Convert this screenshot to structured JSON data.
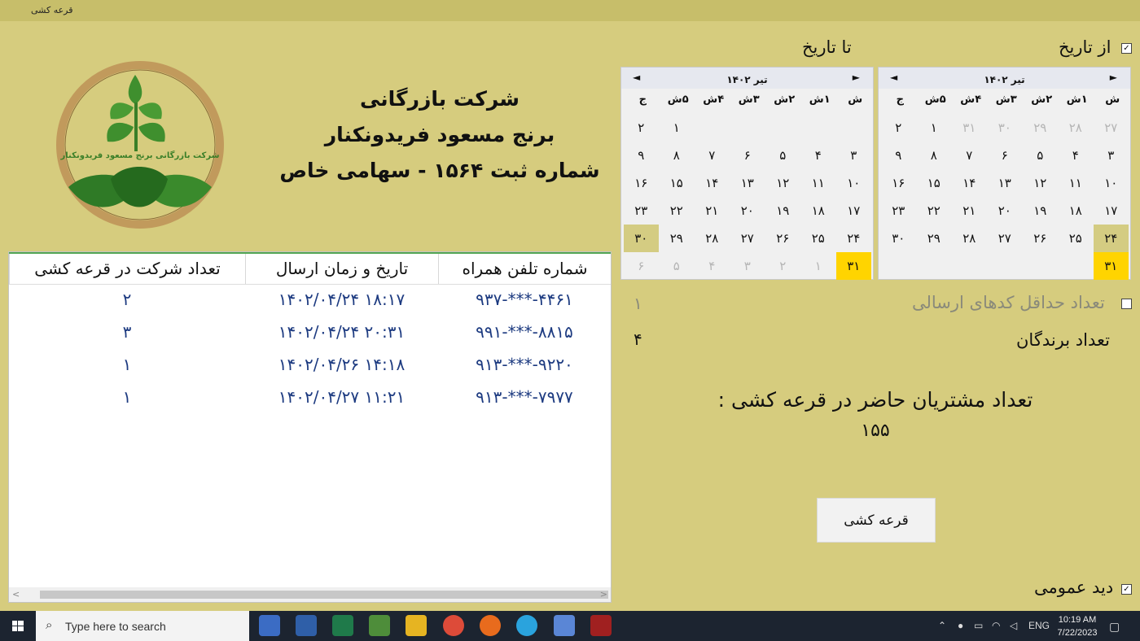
{
  "window": {
    "title": "قرعه کشی"
  },
  "from_date": {
    "label": "از تاریخ",
    "checked": "✓"
  },
  "to_date": {
    "label": "تا تاریخ"
  },
  "calendar_from": {
    "month": "تیر ۱۴۰۲",
    "prev": "◄",
    "next": "►",
    "weekdays": [
      "ش",
      "۱ش",
      "۲ش",
      "۳ش",
      "۴ش",
      "۵ش",
      "ج"
    ],
    "days": [
      {
        "d": "۲۷",
        "dim": true
      },
      {
        "d": "۲۸",
        "dim": true
      },
      {
        "d": "۲۹",
        "dim": true
      },
      {
        "d": "۳۰",
        "dim": true
      },
      {
        "d": "۳۱",
        "dim": true
      },
      {
        "d": "۱"
      },
      {
        "d": "۲"
      },
      {
        "d": "۳"
      },
      {
        "d": "۴"
      },
      {
        "d": "۵"
      },
      {
        "d": "۶"
      },
      {
        "d": "۷"
      },
      {
        "d": "۸"
      },
      {
        "d": "۹"
      },
      {
        "d": "۱۰"
      },
      {
        "d": "۱۱"
      },
      {
        "d": "۱۲"
      },
      {
        "d": "۱۳"
      },
      {
        "d": "۱۴"
      },
      {
        "d": "۱۵"
      },
      {
        "d": "۱۶"
      },
      {
        "d": "۱۷"
      },
      {
        "d": "۱۸"
      },
      {
        "d": "۱۹"
      },
      {
        "d": "۲۰"
      },
      {
        "d": "۲۱"
      },
      {
        "d": "۲۲"
      },
      {
        "d": "۲۳"
      },
      {
        "d": "۲۴",
        "hl": true
      },
      {
        "d": "۲۵"
      },
      {
        "d": "۲۶"
      },
      {
        "d": "۲۷"
      },
      {
        "d": "۲۸"
      },
      {
        "d": "۲۹"
      },
      {
        "d": "۳۰"
      },
      {
        "d": "۳۱",
        "sel": true
      }
    ]
  },
  "calendar_to": {
    "month": "تیر ۱۴۰۲",
    "prev": "◄",
    "next": "►",
    "weekdays": [
      "ش",
      "۱ش",
      "۲ش",
      "۳ش",
      "۴ش",
      "۵ش",
      "ج"
    ],
    "days": [
      {
        "d": ""
      },
      {
        "d": ""
      },
      {
        "d": ""
      },
      {
        "d": ""
      },
      {
        "d": ""
      },
      {
        "d": "۱"
      },
      {
        "d": "۲"
      },
      {
        "d": "۳"
      },
      {
        "d": "۴"
      },
      {
        "d": "۵"
      },
      {
        "d": "۶"
      },
      {
        "d": "۷"
      },
      {
        "d": "۸"
      },
      {
        "d": "۹"
      },
      {
        "d": "۱۰"
      },
      {
        "d": "۱۱"
      },
      {
        "d": "۱۲"
      },
      {
        "d": "۱۳"
      },
      {
        "d": "۱۴"
      },
      {
        "d": "۱۵"
      },
      {
        "d": "۱۶"
      },
      {
        "d": "۱۷"
      },
      {
        "d": "۱۸"
      },
      {
        "d": "۱۹"
      },
      {
        "d": "۲۰"
      },
      {
        "d": "۲۱"
      },
      {
        "d": "۲۲"
      },
      {
        "d": "۲۳"
      },
      {
        "d": "۲۴"
      },
      {
        "d": "۲۵"
      },
      {
        "d": "۲۶"
      },
      {
        "d": "۲۷"
      },
      {
        "d": "۲۸"
      },
      {
        "d": "۲۹"
      },
      {
        "d": "۳۰",
        "hl": true
      },
      {
        "d": "۳۱",
        "sel": true
      },
      {
        "d": "۱",
        "dim": true
      },
      {
        "d": "۲",
        "dim": true
      },
      {
        "d": "۳",
        "dim": true
      },
      {
        "d": "۴",
        "dim": true
      },
      {
        "d": "۵",
        "dim": true
      },
      {
        "d": "۶",
        "dim": true
      }
    ]
  },
  "min_codes": {
    "label": "تعداد حداقل کدهای ارسالی",
    "value": "۱"
  },
  "winners": {
    "label": "تعداد برندگان",
    "value": "۴"
  },
  "company": {
    "line1": "شرکت بازرگانی",
    "line2": "برنج مسعود فریدونکنار",
    "line3": "شماره ثبت ۱۵۶۴ - سهامی خاص"
  },
  "table": {
    "headers": [
      "شماره تلفن همراه",
      "تاریخ و زمان ارسال",
      "تعداد شرکت در قرعه کشی"
    ],
    "rows": [
      [
        "۹۳۷-***-۴۴۶۱",
        "۱۴۰۲/۰۴/۲۴ ۱۸:۱۷",
        "۲"
      ],
      [
        "۹۹۱-***-۸۸۱۵",
        "۱۴۰۲/۰۴/۲۴ ۲۰:۳۱",
        "۳"
      ],
      [
        "۹۱۳-***-۹۲۲۰",
        "۱۴۰۲/۰۴/۲۶ ۱۴:۱۸",
        "۱"
      ],
      [
        "۹۱۳-***-۷۹۷۷",
        "۱۴۰۲/۰۴/۲۷ ۱۱:۲۱",
        "۱"
      ]
    ]
  },
  "customers": {
    "label": "تعداد مشتریان حاضر در قرعه کشی :",
    "value": "۱۵۵"
  },
  "draw_button": {
    "label": "قرعه کشی"
  },
  "general_view": {
    "label": "دید عمومی",
    "checked": "✓"
  },
  "taskbar": {
    "search_placeholder": "Type here to search",
    "lang": "ENG",
    "time": "10:19 AM",
    "date": "7/22/2023"
  },
  "colors": {
    "background": "#d6cc7e",
    "selected_day": "#ffd400",
    "table_text": "#1c3a80"
  }
}
